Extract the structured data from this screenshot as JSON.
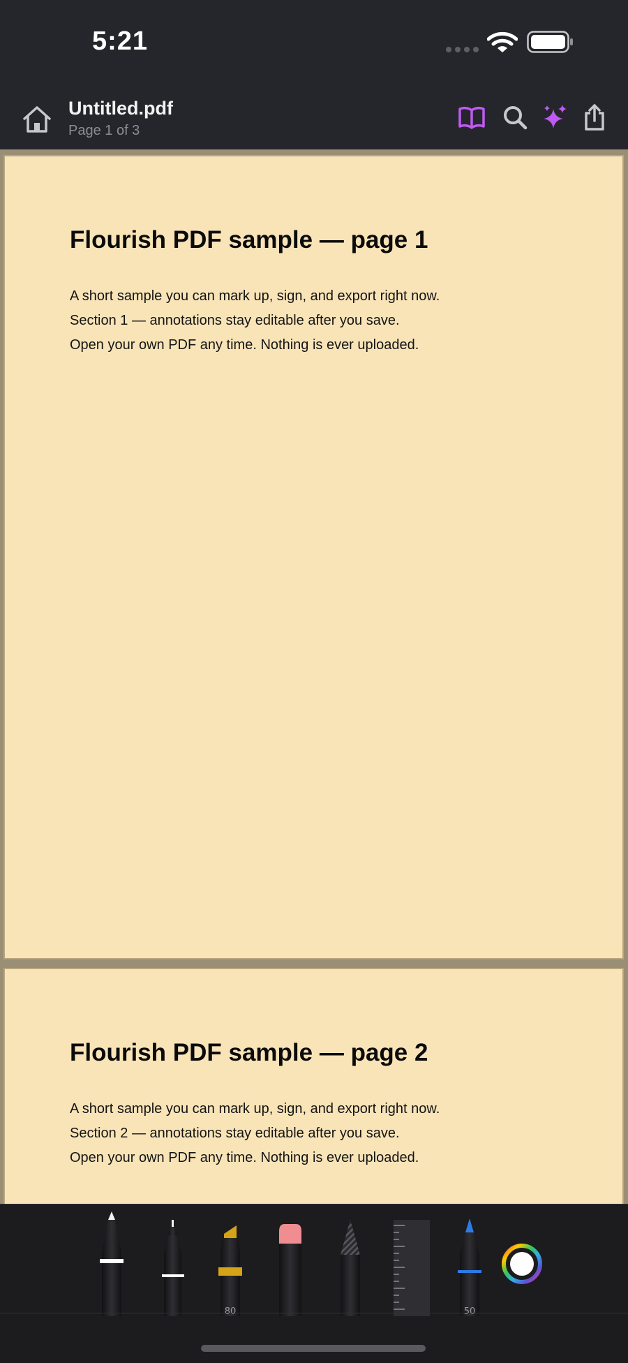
{
  "status_bar": {
    "time": "5:21",
    "icons": [
      "signal-dots-icon",
      "wifi-icon",
      "battery-icon"
    ]
  },
  "nav": {
    "title": "Untitled.pdf",
    "subtitle": "Page 1 of 3",
    "icons": {
      "home": "home-icon",
      "reader": "book-icon",
      "search": "search-icon",
      "ai": "sparkles-icon",
      "share": "share-icon"
    },
    "accent_color": "#bf5af2"
  },
  "pages": [
    {
      "heading": "Flourish PDF sample — page 1",
      "lines": [
        "A short sample you can mark up, sign, and export right now.",
        "Section 1 — annotations stay editable after you save.",
        "Open your own PDF any time. Nothing is ever uploaded."
      ]
    },
    {
      "heading": "Flourish PDF sample — page 2",
      "lines": [
        "A short sample you can mark up, sign, and export right now.",
        "Section 2 — annotations stay editable after you save.",
        "Open your own PDF any time. Nothing is ever uploaded."
      ]
    }
  ],
  "toolbar": {
    "tools": [
      {
        "name": "pen",
        "icon": "pen-icon",
        "selected": true
      },
      {
        "name": "fineliner",
        "icon": "fineliner-icon"
      },
      {
        "name": "highlighter",
        "icon": "highlighter-icon",
        "value": "80",
        "color": "#d4a317"
      },
      {
        "name": "eraser",
        "icon": "eraser-icon",
        "color": "#f08d90"
      },
      {
        "name": "lasso",
        "icon": "lasso-icon"
      },
      {
        "name": "ruler",
        "icon": "ruler-icon"
      },
      {
        "name": "marker",
        "icon": "marker-icon",
        "value": "50",
        "color": "#2f7be6"
      }
    ],
    "color_picker_icon": "color-wheel-icon"
  },
  "colors": {
    "chrome_background": "#25262b",
    "page_background": "#f9e4b8",
    "desk_background": "#9a8e74"
  }
}
